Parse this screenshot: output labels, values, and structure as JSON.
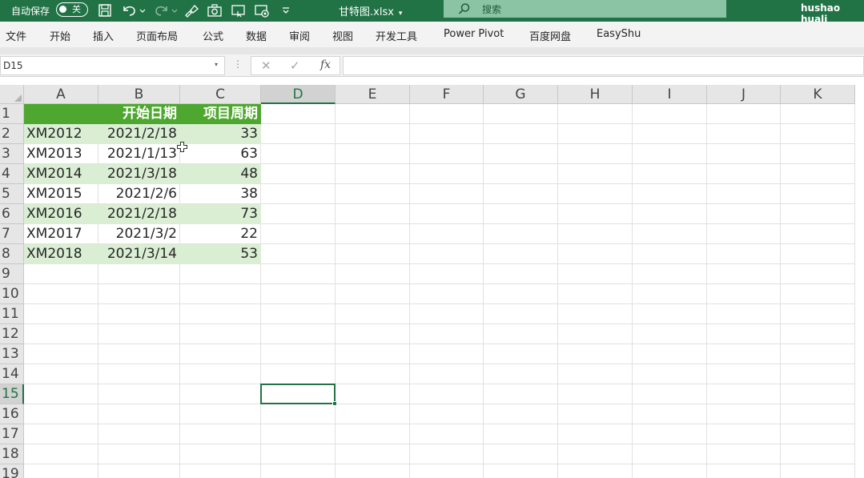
{
  "titlebar": {
    "autosave_label": "自动保存",
    "autosave_state": "关",
    "filename": "甘特图.xlsx",
    "filename_caret": "▾",
    "search_placeholder": "搜索",
    "username": "hushao huali"
  },
  "ribbon": {
    "tabs": [
      "文件",
      "开始",
      "插入",
      "页面布局",
      "公式",
      "数据",
      "审阅",
      "视图",
      "开发工具",
      "Power Pivot",
      "百度网盘",
      "EasyShu"
    ]
  },
  "formula_bar": {
    "name_box": "D15",
    "name_caret": "▾",
    "more": "⋮",
    "cancel": "✕",
    "enter": "✓",
    "fx": "fx",
    "value": ""
  },
  "grid": {
    "columns": [
      "A",
      "B",
      "C",
      "D",
      "E",
      "F",
      "G",
      "H",
      "I",
      "J",
      "K"
    ],
    "rows": [
      "1",
      "2",
      "3",
      "4",
      "5",
      "6",
      "7",
      "8",
      "9",
      "10",
      "11",
      "12",
      "13",
      "14",
      "15",
      "16",
      "17",
      "18",
      "19"
    ],
    "selected_cell": "D15",
    "header_row": [
      "",
      "开始日期",
      "项目周期"
    ],
    "data_rows": [
      [
        "XM2012",
        "2021/2/18",
        "33"
      ],
      [
        "XM2013",
        "2021/1/13",
        "63"
      ],
      [
        "XM2014",
        "2021/3/18",
        "48"
      ],
      [
        "XM2015",
        "2021/2/6",
        "38"
      ],
      [
        "XM2016",
        "2021/2/18",
        "73"
      ],
      [
        "XM2017",
        "2021/3/2",
        "22"
      ],
      [
        "XM2018",
        "2021/3/14",
        "53"
      ]
    ]
  },
  "colors": {
    "excel_green": "#217346",
    "table_header": "#4ea72e",
    "table_band": "#d9eed3"
  }
}
